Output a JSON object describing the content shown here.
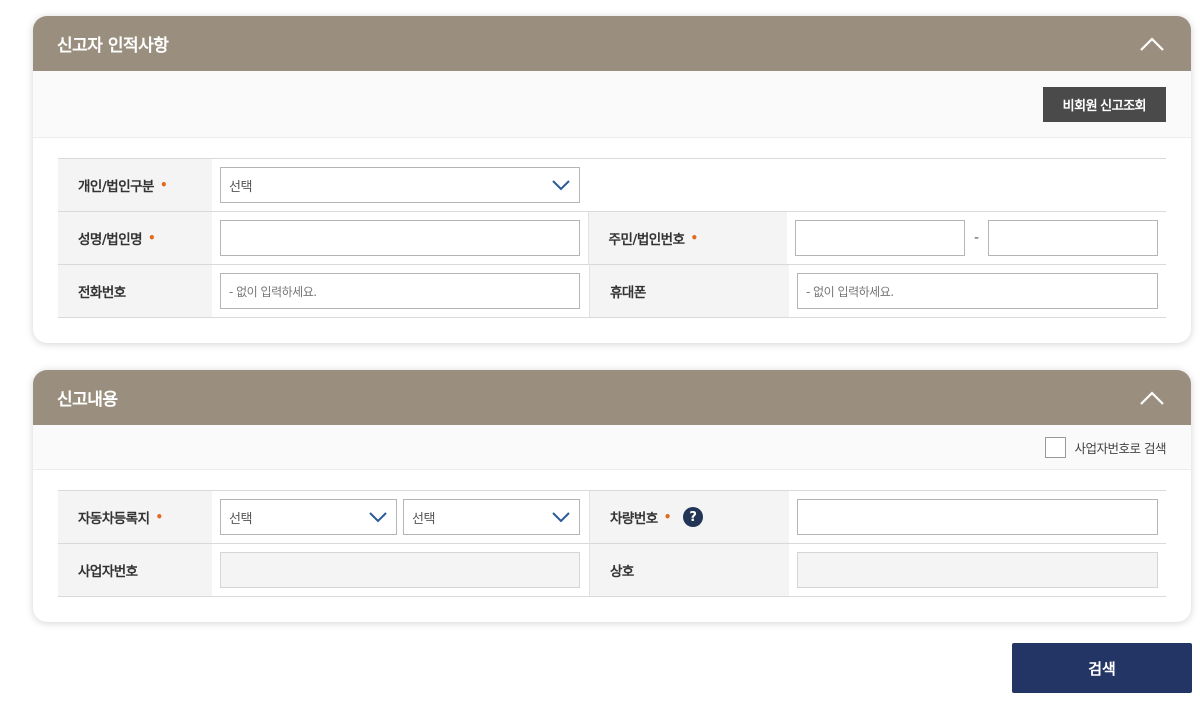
{
  "reporter": {
    "title": "신고자 인적사항",
    "nonmember_button": "비회원 신고조회",
    "type_label": "개인/법인구분",
    "type_value": "선택",
    "name_label": "성명/법인명",
    "idnum_label": "주민/법인번호",
    "idnum_separator": "-",
    "phone_label": "전화번호",
    "phone_placeholder": "- 없이 입력하세요.",
    "mobile_label": "휴대폰",
    "mobile_placeholder": "- 없이 입력하세요."
  },
  "content": {
    "title": "신고내용",
    "bizno_checkbox_label": "사업자번호로 검색",
    "registry_label": "자동차등록지",
    "registry_select1": "선택",
    "registry_select2": "선택",
    "vehicle_no_label": "차량번호",
    "help_glyph": "?",
    "bizno_label": "사업자번호",
    "company_label": "상호"
  },
  "required_mark": "•",
  "search_button": "검색",
  "icons": {
    "collapse": "chevron-up-icon",
    "select_arrow": "chevron-down-icon",
    "help": "question-circle-icon"
  },
  "colors": {
    "header_bg": "#9a8f7e",
    "dark_button": "#4a4a4a",
    "primary": "#233564",
    "required": "#e16a1c"
  }
}
